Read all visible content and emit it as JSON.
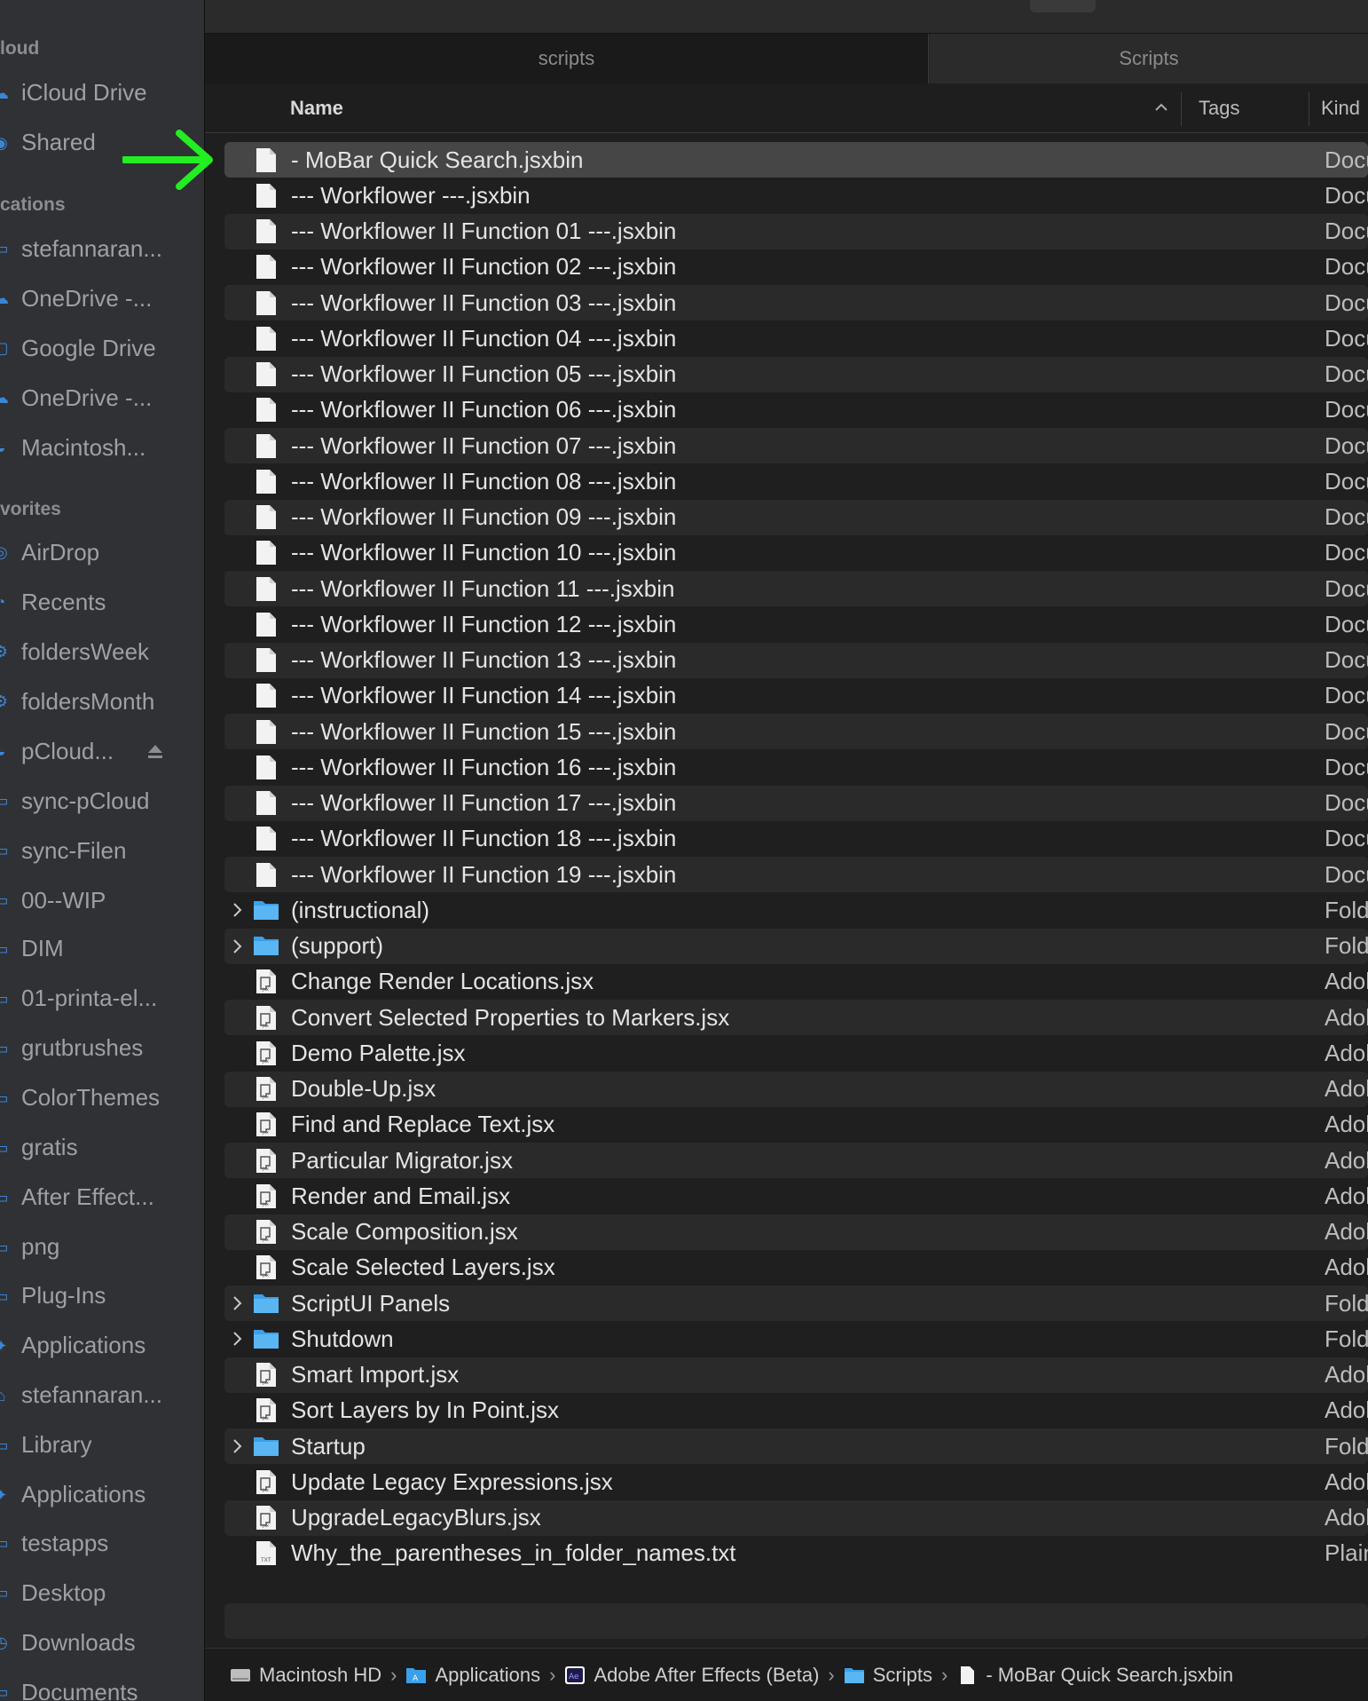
{
  "sidebar": {
    "sections": [
      {
        "title": "loud",
        "items": [
          {
            "label": "iCloud Drive",
            "icon": "icloud-drive-icon"
          },
          {
            "label": "Shared",
            "icon": "shared-folder-icon"
          }
        ]
      },
      {
        "title": "cations",
        "items": [
          {
            "label": "stefannaran...",
            "icon": "computer-icon"
          },
          {
            "label": "OneDrive -...",
            "icon": "cloud-icon"
          },
          {
            "label": "Google Drive",
            "icon": "drive-icon"
          },
          {
            "label": "OneDrive -...",
            "icon": "cloud-icon"
          },
          {
            "label": "Macintosh...",
            "icon": "disk-icon"
          }
        ]
      },
      {
        "title": "vorites",
        "items": [
          {
            "label": "AirDrop",
            "icon": "airdrop-icon"
          },
          {
            "label": "Recents",
            "icon": "clock-icon"
          },
          {
            "label": "foldersWeek",
            "icon": "smart-folder-icon"
          },
          {
            "label": "foldersMonth",
            "icon": "smart-folder-icon"
          },
          {
            "label": "pCloud...",
            "icon": "disk-icon",
            "eject": true
          },
          {
            "label": "sync-pCloud",
            "icon": "folder-icon"
          },
          {
            "label": "sync-Filen",
            "icon": "folder-icon"
          },
          {
            "label": "00--WIP",
            "icon": "folder-icon"
          },
          {
            "label": "DIM",
            "icon": "folder-icon"
          },
          {
            "label": "01-printa-el...",
            "icon": "folder-icon"
          },
          {
            "label": "grutbrushes",
            "icon": "folder-icon"
          },
          {
            "label": "ColorThemes",
            "icon": "folder-icon"
          },
          {
            "label": "gratis",
            "icon": "folder-icon"
          },
          {
            "label": "After Effect...",
            "icon": "folder-icon"
          },
          {
            "label": "png",
            "icon": "folder-icon"
          },
          {
            "label": "Plug-Ins",
            "icon": "folder-icon"
          },
          {
            "label": "Applications",
            "icon": "applications-icon"
          },
          {
            "label": "stefannaran...",
            "icon": "home-icon"
          },
          {
            "label": "Library",
            "icon": "folder-icon"
          },
          {
            "label": "Applications",
            "icon": "applications-icon"
          },
          {
            "label": "testapps",
            "icon": "folder-icon"
          },
          {
            "label": "Desktop",
            "icon": "desktop-icon"
          },
          {
            "label": "Downloads",
            "icon": "downloads-icon"
          },
          {
            "label": "Documents",
            "icon": "documents-icon"
          }
        ]
      }
    ]
  },
  "tabs": [
    {
      "label": "scripts",
      "active": true
    },
    {
      "label": "Scripts",
      "active": false
    }
  ],
  "columns": {
    "name": "Name",
    "tags": "Tags",
    "kind": "Kind",
    "sort_icon": "chevron-up-icon"
  },
  "files": [
    {
      "name": "- MoBar Quick Search.jsxbin",
      "kind": "Docu",
      "type": "doc",
      "selected": true
    },
    {
      "name": "--- Workflower ---.jsxbin",
      "kind": "Docu",
      "type": "doc"
    },
    {
      "name": "--- Workflower II Function 01 ---.jsxbin",
      "kind": "Docu",
      "type": "doc"
    },
    {
      "name": "--- Workflower II Function 02 ---.jsxbin",
      "kind": "Docu",
      "type": "doc"
    },
    {
      "name": "--- Workflower II Function 03 ---.jsxbin",
      "kind": "Docu",
      "type": "doc"
    },
    {
      "name": "--- Workflower II Function 04 ---.jsxbin",
      "kind": "Docu",
      "type": "doc"
    },
    {
      "name": "--- Workflower II Function 05 ---.jsxbin",
      "kind": "Docu",
      "type": "doc"
    },
    {
      "name": "--- Workflower II Function 06 ---.jsxbin",
      "kind": "Docu",
      "type": "doc"
    },
    {
      "name": "--- Workflower II Function 07 ---.jsxbin",
      "kind": "Docu",
      "type": "doc"
    },
    {
      "name": "--- Workflower II Function 08 ---.jsxbin",
      "kind": "Docu",
      "type": "doc"
    },
    {
      "name": "--- Workflower II Function 09 ---.jsxbin",
      "kind": "Docu",
      "type": "doc"
    },
    {
      "name": "--- Workflower II Function 10 ---.jsxbin",
      "kind": "Docu",
      "type": "doc"
    },
    {
      "name": "--- Workflower II Function 11 ---.jsxbin",
      "kind": "Docu",
      "type": "doc"
    },
    {
      "name": "--- Workflower II Function 12 ---.jsxbin",
      "kind": "Docu",
      "type": "doc"
    },
    {
      "name": "--- Workflower II Function 13 ---.jsxbin",
      "kind": "Docu",
      "type": "doc"
    },
    {
      "name": "--- Workflower II Function 14 ---.jsxbin",
      "kind": "Docu",
      "type": "doc"
    },
    {
      "name": "--- Workflower II Function 15 ---.jsxbin",
      "kind": "Docu",
      "type": "doc"
    },
    {
      "name": "--- Workflower II Function 16 ---.jsxbin",
      "kind": "Docu",
      "type": "doc"
    },
    {
      "name": "--- Workflower II Function 17 ---.jsxbin",
      "kind": "Docu",
      "type": "doc"
    },
    {
      "name": "--- Workflower II Function 18 ---.jsxbin",
      "kind": "Docu",
      "type": "doc"
    },
    {
      "name": "--- Workflower II Function 19 ---.jsxbin",
      "kind": "Docu",
      "type": "doc"
    },
    {
      "name": "(instructional)",
      "kind": "Fold",
      "type": "folder"
    },
    {
      "name": "(support)",
      "kind": "Fold",
      "type": "folder"
    },
    {
      "name": "Change Render Locations.jsx",
      "kind": "Adob",
      "type": "script"
    },
    {
      "name": "Convert Selected Properties to Markers.jsx",
      "kind": "Adob",
      "type": "script"
    },
    {
      "name": "Demo Palette.jsx",
      "kind": "Adob",
      "type": "script"
    },
    {
      "name": "Double-Up.jsx",
      "kind": "Adob",
      "type": "script"
    },
    {
      "name": "Find and Replace Text.jsx",
      "kind": "Adob",
      "type": "script"
    },
    {
      "name": "Particular Migrator.jsx",
      "kind": "Adob",
      "type": "script"
    },
    {
      "name": "Render and Email.jsx",
      "kind": "Adob",
      "type": "script"
    },
    {
      "name": "Scale Composition.jsx",
      "kind": "Adob",
      "type": "script"
    },
    {
      "name": "Scale Selected Layers.jsx",
      "kind": "Adob",
      "type": "script"
    },
    {
      "name": "ScriptUI Panels",
      "kind": "Fold",
      "type": "folder"
    },
    {
      "name": "Shutdown",
      "kind": "Fold",
      "type": "folder"
    },
    {
      "name": "Smart Import.jsx",
      "kind": "Adob",
      "type": "script"
    },
    {
      "name": "Sort Layers by In Point.jsx",
      "kind": "Adob",
      "type": "script"
    },
    {
      "name": "Startup",
      "kind": "Fold",
      "type": "folder"
    },
    {
      "name": "Update Legacy Expressions.jsx",
      "kind": "Adob",
      "type": "script"
    },
    {
      "name": "UpgradeLegacyBlurs.jsx",
      "kind": "Adob",
      "type": "script"
    },
    {
      "name": "Why_the_parentheses_in_folder_names.txt",
      "kind": "Plain",
      "type": "txt"
    }
  ],
  "pathbar": [
    {
      "label": "Macintosh HD",
      "icon": "hard-drive-icon"
    },
    {
      "label": "Applications",
      "icon": "applications-folder-icon"
    },
    {
      "label": "Adobe After Effects (Beta)",
      "icon": "after-effects-icon"
    },
    {
      "label": "Scripts",
      "icon": "folder-icon"
    },
    {
      "label": "- MoBar Quick Search.jsxbin",
      "icon": "document-icon"
    }
  ],
  "colors": {
    "accent_folder": "#3aa0ea",
    "annotation_arrow": "#22ee22",
    "selection": "#464646"
  }
}
